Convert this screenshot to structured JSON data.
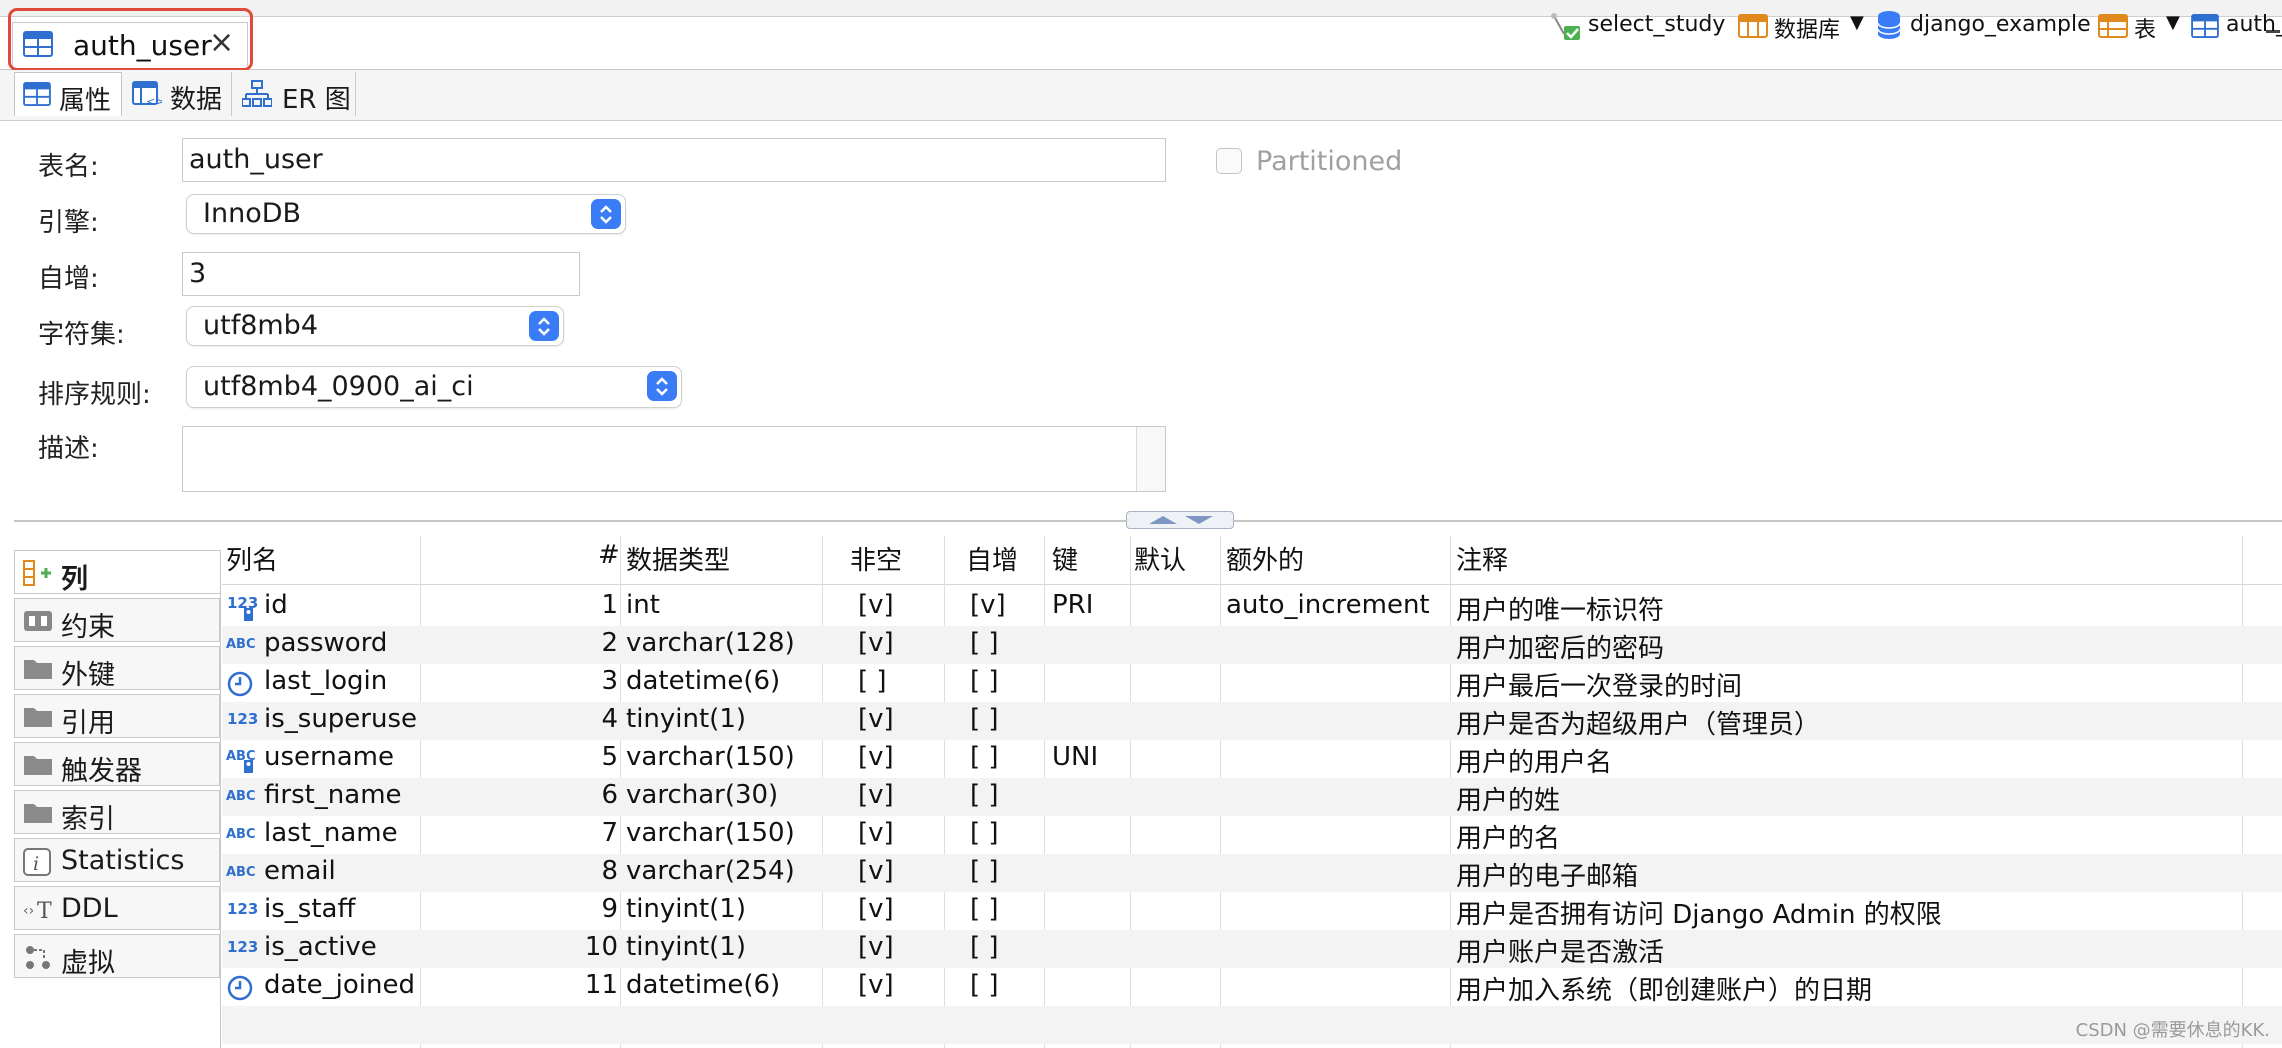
{
  "editor_tab": {
    "title": "auth_user",
    "close": "×"
  },
  "subtabs": [
    {
      "label": "属性"
    },
    {
      "label": "数据"
    },
    {
      "label": "ER 图"
    }
  ],
  "breadcrumb": {
    "connection": "select_study",
    "database_label": "数据库",
    "database": "django_example",
    "table_label": "表",
    "table": "auth_"
  },
  "form": {
    "table_name_label": "表名:",
    "table_name": "auth_user",
    "partitioned_label": "Partitioned",
    "engine_label": "引擎:",
    "engine": "InnoDB",
    "auto_inc_label": "自增:",
    "auto_inc": "3",
    "charset_label": "字符集:",
    "charset": "utf8mb4",
    "collation_label": "排序规则:",
    "collation": "utf8mb4_0900_ai_ci",
    "description_label": "描述:",
    "description": ""
  },
  "nav": [
    {
      "label": "列",
      "icon": "columns-icon"
    },
    {
      "label": "约束",
      "icon": "constraint-icon"
    },
    {
      "label": "外键",
      "icon": "folder-icon"
    },
    {
      "label": "引用",
      "icon": "folder-icon"
    },
    {
      "label": "触发器",
      "icon": "folder-icon"
    },
    {
      "label": "索引",
      "icon": "folder-icon"
    },
    {
      "label": "Statistics",
      "icon": "info-icon"
    },
    {
      "label": "DDL",
      "icon": "ddl-icon"
    },
    {
      "label": "虚拟",
      "icon": "virtual-icon"
    }
  ],
  "table": {
    "headers": {
      "name": "列名",
      "pos": "#",
      "type": "数据类型",
      "notnull": "非空",
      "autoinc": "自增",
      "key": "键",
      "default": "默认",
      "extra": "额外的",
      "comment": "注释"
    },
    "rows": [
      {
        "icon": "numeric-key",
        "name": "id",
        "pos": "1",
        "type": "int",
        "notnull": "[v]",
        "autoinc": "[v]",
        "key": "PRI",
        "default": "",
        "extra": "auto_increment",
        "comment": "用户的唯一标识符"
      },
      {
        "icon": "text",
        "name": "password",
        "pos": "2",
        "type": "varchar(128)",
        "notnull": "[v]",
        "autoinc": "[ ]",
        "key": "",
        "default": "",
        "extra": "",
        "comment": "用户加密后的密码"
      },
      {
        "icon": "clock",
        "name": "last_login",
        "pos": "3",
        "type": "datetime(6)",
        "notnull": "[ ]",
        "autoinc": "[ ]",
        "key": "",
        "default": "",
        "extra": "",
        "comment": "用户最后一次登录的时间"
      },
      {
        "icon": "numeric",
        "name": "is_superuse",
        "pos": "4",
        "type": "tinyint(1)",
        "notnull": "[v]",
        "autoinc": "[ ]",
        "key": "",
        "default": "",
        "extra": "",
        "comment": "用户是否为超级用户（管理员）"
      },
      {
        "icon": "text-key",
        "name": "username",
        "pos": "5",
        "type": "varchar(150)",
        "notnull": "[v]",
        "autoinc": "[ ]",
        "key": "UNI",
        "default": "",
        "extra": "",
        "comment": "用户的用户名"
      },
      {
        "icon": "text",
        "name": "first_name",
        "pos": "6",
        "type": "varchar(30)",
        "notnull": "[v]",
        "autoinc": "[ ]",
        "key": "",
        "default": "",
        "extra": "",
        "comment": "用户的姓"
      },
      {
        "icon": "text",
        "name": "last_name",
        "pos": "7",
        "type": "varchar(150)",
        "notnull": "[v]",
        "autoinc": "[ ]",
        "key": "",
        "default": "",
        "extra": "",
        "comment": "用户的名"
      },
      {
        "icon": "text",
        "name": "email",
        "pos": "8",
        "type": "varchar(254)",
        "notnull": "[v]",
        "autoinc": "[ ]",
        "key": "",
        "default": "",
        "extra": "",
        "comment": "用户的电子邮箱"
      },
      {
        "icon": "numeric",
        "name": "is_staff",
        "pos": "9",
        "type": "tinyint(1)",
        "notnull": "[v]",
        "autoinc": "[ ]",
        "key": "",
        "default": "",
        "extra": "",
        "comment": "用户是否拥有访问 Django Admin 的权限"
      },
      {
        "icon": "numeric",
        "name": "is_active",
        "pos": "10",
        "type": "tinyint(1)",
        "notnull": "[v]",
        "autoinc": "[ ]",
        "key": "",
        "default": "",
        "extra": "",
        "comment": "用户账户是否激活"
      },
      {
        "icon": "clock",
        "name": "date_joined",
        "pos": "11",
        "type": "datetime(6)",
        "notnull": "[v]",
        "autoinc": "[ ]",
        "key": "",
        "default": "",
        "extra": "",
        "comment": "用户加入系统（即创建账户）的日期"
      }
    ]
  },
  "watermark": "CSDN @需要休息的KK.",
  "colors": {
    "accent": "#3a7cf6",
    "highlight": "#e04a3a",
    "icon_blue": "#2f6fd0",
    "icon_orange": "#e08a1e"
  }
}
